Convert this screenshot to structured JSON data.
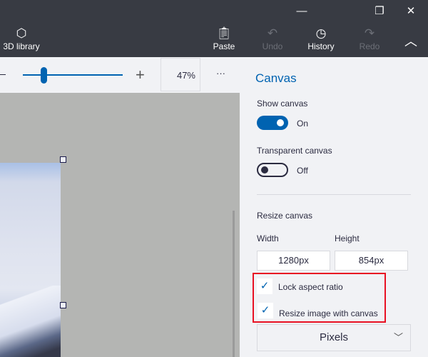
{
  "window": {
    "minimize_icon": "minimize-icon",
    "restore_icon": "restore-icon",
    "close_icon": "close-icon"
  },
  "toolbar": {
    "library_label": "3D library",
    "paste_label": "Paste",
    "undo_label": "Undo",
    "history_label": "History",
    "redo_label": "Redo"
  },
  "zoom": {
    "value": "47%",
    "level_percent": 47,
    "more": "···"
  },
  "panel": {
    "title": "Canvas",
    "show_canvas_label": "Show canvas",
    "show_canvas_state": "On",
    "transparent_label": "Transparent canvas",
    "transparent_state": "Off",
    "resize_label": "Resize canvas",
    "width_label": "Width",
    "height_label": "Height",
    "width_value": "1280px",
    "height_value": "854px",
    "lock_aspect_label": "Lock aspect ratio",
    "lock_aspect_checked": true,
    "resize_image_label": "Resize image with canvas",
    "resize_image_checked": true,
    "units_value": "Pixels"
  },
  "colors": {
    "accent": "#0063b1",
    "titlebar": "#383b43",
    "highlight": "#e81123"
  }
}
